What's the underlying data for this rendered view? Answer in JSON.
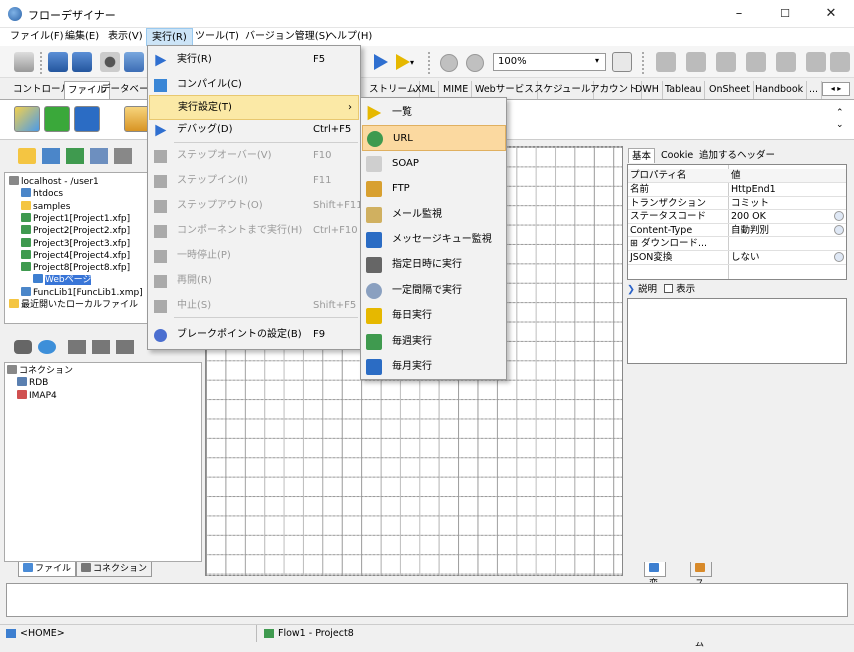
{
  "window": {
    "title": "フローデザイナー",
    "minimize": "–",
    "maximize": "☐",
    "close": "✕"
  },
  "menubar": [
    "ファイル(F)",
    "編集(E)",
    "表示(V)",
    "実行(R)",
    "ツール(T)",
    "バージョン管理(S)",
    "ヘルプ(H)"
  ],
  "toolbar": {
    "zoom": "100%"
  },
  "component_tabs": [
    "コントロール",
    "ファイル",
    "データベース",
    "ストリーム",
    "XML",
    "MIME",
    "Webサービス",
    "スケジュール",
    "アカウント",
    "DWH",
    "Tableau",
    "OnSheet",
    "Handbook",
    "..."
  ],
  "tree": {
    "items": [
      {
        "label": "localhost - /user1",
        "indent": 0
      },
      {
        "label": "htdocs",
        "indent": 1
      },
      {
        "label": "samples",
        "indent": 1
      },
      {
        "label": "Project1[Project1.xfp]",
        "indent": 1
      },
      {
        "label": "Project2[Project2.xfp]",
        "indent": 1
      },
      {
        "label": "Project3[Project3.xfp]",
        "indent": 1
      },
      {
        "label": "Project4[Project4.xfp]",
        "indent": 1
      },
      {
        "label": "Project8[Project8.xfp]",
        "indent": 1
      },
      {
        "label": "Webページ",
        "indent": 2
      },
      {
        "label": "FuncLib1[FuncLib1.xmp]",
        "indent": 1
      },
      {
        "label": "最近開いたローカルファイル",
        "indent": 0
      }
    ]
  },
  "connections": {
    "items": [
      {
        "label": "コネクション",
        "indent": 0
      },
      {
        "label": "RDB",
        "indent": 1
      },
      {
        "label": "IMAP4",
        "indent": 1
      }
    ]
  },
  "left_bottom_tabs": [
    "ファイル",
    "コネクション"
  ],
  "run_menu": {
    "items": [
      {
        "label": "実行(R)",
        "shortcut": "F5",
        "disabled": false
      },
      {
        "label": "コンパイル(C)",
        "shortcut": "",
        "disabled": false
      },
      {
        "label": "実行設定(T)",
        "shortcut": "›",
        "disabled": false
      },
      {
        "label": "デバッグ(D)",
        "shortcut": "Ctrl+F5",
        "disabled": false
      },
      {
        "label": "ステップオーバー(V)",
        "shortcut": "F10",
        "disabled": true
      },
      {
        "label": "ステップイン(I)",
        "shortcut": "F11",
        "disabled": true
      },
      {
        "label": "ステップアウト(O)",
        "shortcut": "Shift+F11",
        "disabled": true
      },
      {
        "label": "コンポーネントまで実行(H)",
        "shortcut": "Ctrl+F10",
        "disabled": true
      },
      {
        "label": "一時停止(P)",
        "shortcut": "",
        "disabled": true
      },
      {
        "label": "再開(R)",
        "shortcut": "",
        "disabled": true
      },
      {
        "label": "中止(S)",
        "shortcut": "Shift+F5",
        "disabled": true
      },
      {
        "label": "ブレークポイントの設定(B)",
        "shortcut": "F9",
        "disabled": false
      }
    ]
  },
  "run_settings_submenu": [
    "一覧",
    "URL",
    "SOAP",
    "FTP",
    "メール監視",
    "メッセージキュー監視",
    "指定日時に実行",
    "一定間隔で実行",
    "毎日実行",
    "毎週実行",
    "毎月実行"
  ],
  "property_tabs": [
    "基本",
    "Cookie",
    "追加するヘッダー"
  ],
  "property_table": {
    "header": [
      "プロパティ名",
      "値"
    ],
    "rows": [
      {
        "key": "名前",
        "value": "HttpEnd1"
      },
      {
        "key": "トランザクション",
        "value": "コミット"
      },
      {
        "key": "ステータスコード",
        "value": "200 OK"
      },
      {
        "key": "Content-Type",
        "value": "自動判別"
      },
      {
        "key": "⊞ ダウンロード...",
        "value": ""
      },
      {
        "key": "JSON変換",
        "value": "しない"
      }
    ]
  },
  "description": {
    "label": "説明",
    "checkbox_label": "表示"
  },
  "right_bottom_tabs": [
    "変数",
    "ストリーム"
  ],
  "statusbar": {
    "left": "<HOME>",
    "center": "Flow1 - Project8"
  },
  "colors": {
    "menu_highlight": "#fbe9a6",
    "submenu_highlight": "#fbd9a0",
    "menu_active": "#cce4f7"
  }
}
